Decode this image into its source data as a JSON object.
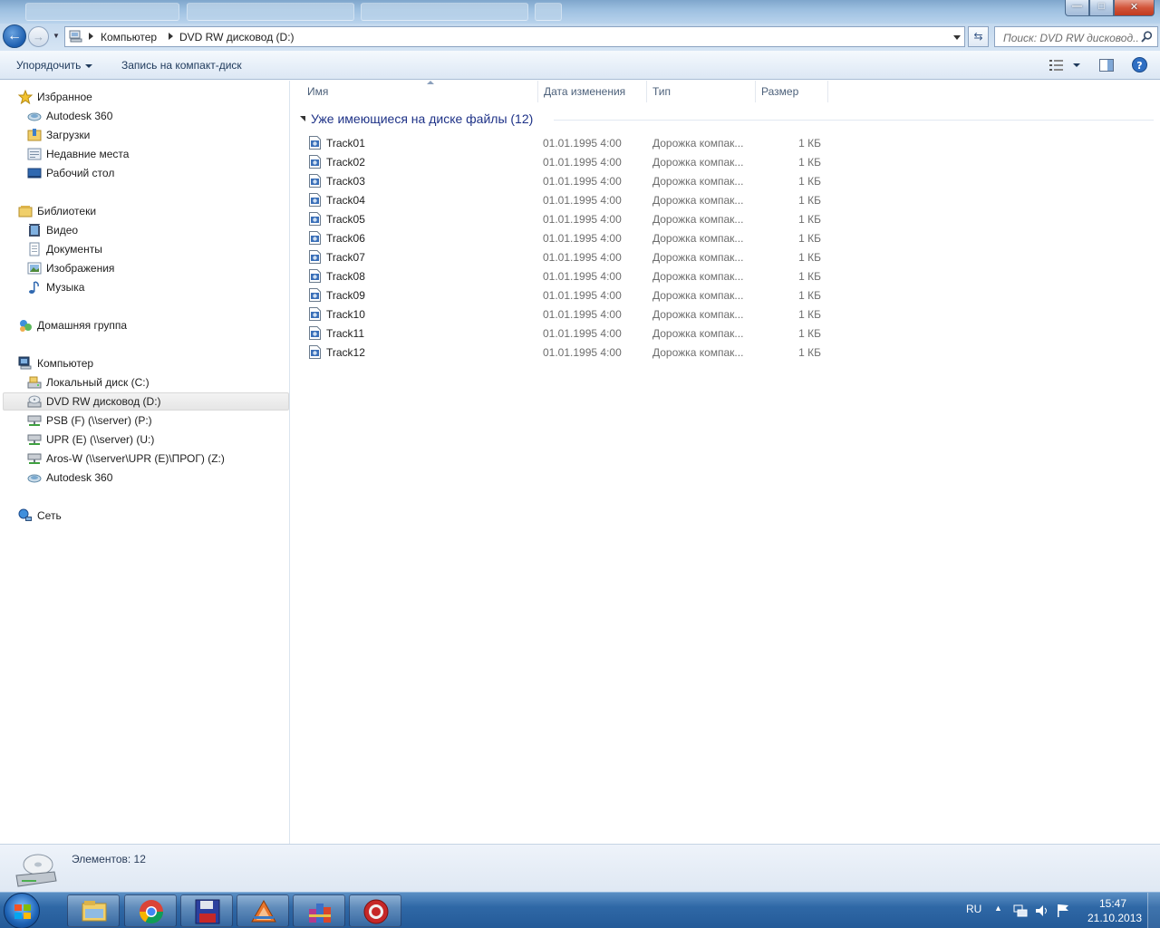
{
  "window": {
    "controls": {
      "minimize": "—",
      "maximize": "□",
      "close": "✕"
    }
  },
  "address": {
    "crumbs": [
      "Компьютер",
      "DVD RW дисковод (D:)"
    ],
    "search_placeholder": "Поиск: DVD RW дисковод..."
  },
  "toolbar": {
    "organize": "Упорядочить",
    "burn": "Запись на компакт-диск"
  },
  "nav": {
    "favorites": {
      "label": "Избранное",
      "items": [
        "Autodesk 360",
        "Загрузки",
        "Недавние места",
        "Рабочий стол"
      ]
    },
    "libraries": {
      "label": "Библиотеки",
      "items": [
        "Видео",
        "Документы",
        "Изображения",
        "Музыка"
      ]
    },
    "homegroup": "Домашняя группа",
    "computer": {
      "label": "Компьютер",
      "items": [
        "Локальный диск (C:)",
        "DVD RW дисковод (D:)",
        "PSB (F) (\\\\server) (P:)",
        "UPR (E) (\\\\server) (U:)",
        "Aros-W (\\\\server\\UPR (E)\\ПРОГ) (Z:)",
        "Autodesk 360"
      ],
      "selected_index": 1
    },
    "network": "Сеть"
  },
  "columns": {
    "name": "Имя",
    "date": "Дата изменения",
    "type": "Тип",
    "size": "Размер"
  },
  "group": {
    "title": "Уже имеющиеся на диске файлы (12)"
  },
  "files": [
    {
      "name": "Track01",
      "date": "01.01.1995 4:00",
      "type": "Дорожка компак...",
      "size": "1 КБ"
    },
    {
      "name": "Track02",
      "date": "01.01.1995 4:00",
      "type": "Дорожка компак...",
      "size": "1 КБ"
    },
    {
      "name": "Track03",
      "date": "01.01.1995 4:00",
      "type": "Дорожка компак...",
      "size": "1 КБ"
    },
    {
      "name": "Track04",
      "date": "01.01.1995 4:00",
      "type": "Дорожка компак...",
      "size": "1 КБ"
    },
    {
      "name": "Track05",
      "date": "01.01.1995 4:00",
      "type": "Дорожка компак...",
      "size": "1 КБ"
    },
    {
      "name": "Track06",
      "date": "01.01.1995 4:00",
      "type": "Дорожка компак...",
      "size": "1 КБ"
    },
    {
      "name": "Track07",
      "date": "01.01.1995 4:00",
      "type": "Дорожка компак...",
      "size": "1 КБ"
    },
    {
      "name": "Track08",
      "date": "01.01.1995 4:00",
      "type": "Дорожка компак...",
      "size": "1 КБ"
    },
    {
      "name": "Track09",
      "date": "01.01.1995 4:00",
      "type": "Дорожка компак...",
      "size": "1 КБ"
    },
    {
      "name": "Track10",
      "date": "01.01.1995 4:00",
      "type": "Дорожка компак...",
      "size": "1 КБ"
    },
    {
      "name": "Track11",
      "date": "01.01.1995 4:00",
      "type": "Дорожка компак...",
      "size": "1 КБ"
    },
    {
      "name": "Track12",
      "date": "01.01.1995 4:00",
      "type": "Дорожка компак...",
      "size": "1 КБ"
    }
  ],
  "details": {
    "count_text": "Элементов: 12"
  },
  "taskbar": {
    "apps": [
      "explorer-icon",
      "chrome-icon",
      "floppy-app-icon",
      "autodesk-app-icon",
      "winrar-icon",
      "opera-icon"
    ],
    "lang": "RU",
    "time": "15:47",
    "date": "21.10.2013"
  }
}
